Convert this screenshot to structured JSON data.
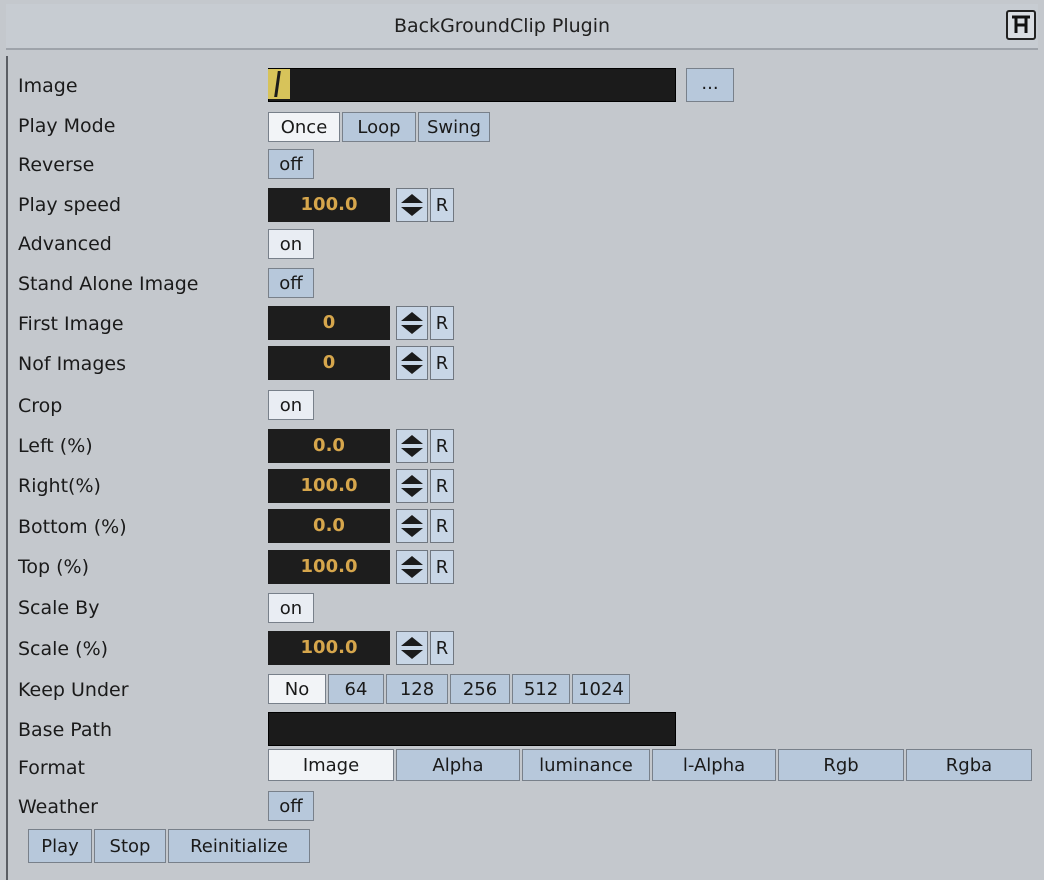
{
  "window": {
    "title": "BackGroundClip Plugin"
  },
  "fields": {
    "image_label": "Image",
    "image_value": ".\\",
    "browse_label": "...",
    "play_mode_label": "Play Mode",
    "play_mode_options": [
      "Once",
      "Loop",
      "Swing"
    ],
    "play_mode_selected": "Once",
    "reverse_label": "Reverse",
    "reverse_value": "off",
    "play_speed_label": "Play speed",
    "play_speed_value": "100.0",
    "advanced_label": "Advanced",
    "advanced_value": "on",
    "stand_alone_label": "Stand Alone Image",
    "stand_alone_value": "off",
    "first_image_label": "First Image",
    "first_image_value": "0",
    "nof_images_label": "Nof Images",
    "nof_images_value": "0",
    "crop_label": "Crop",
    "crop_value": "on",
    "left_label": "Left (%)",
    "left_value": "0.0",
    "right_label": "Right(%)",
    "right_value": "100.0",
    "bottom_label": "Bottom (%)",
    "bottom_value": "0.0",
    "top_label": "Top (%)",
    "top_value": "100.0",
    "scale_by_label": "Scale By",
    "scale_by_value": "on",
    "scale_label": "Scale (%)",
    "scale_value": "100.0",
    "keep_under_label": "Keep Under",
    "keep_under_options": [
      "No",
      "64",
      "128",
      "256",
      "512",
      "1024"
    ],
    "keep_under_selected": "No",
    "base_path_label": "Base Path",
    "base_path_value": "",
    "format_label": "Format",
    "format_options": [
      "Image",
      "Alpha",
      "luminance",
      "l-Alpha",
      "Rgb",
      "Rgba"
    ],
    "format_selected": "Image",
    "weather_label": "Weather",
    "weather_value": "off",
    "reset_label": "R"
  },
  "actions": {
    "play": "Play",
    "stop": "Stop",
    "reinitialize": "Reinitialize"
  },
  "colors": {
    "background": "#c4c8cd",
    "field": "#1b1b1b",
    "number": "#d6a64c",
    "button": "#b7c8db",
    "button_active": "#f2f4f7"
  },
  "icons": {
    "title_icon": "plugin-icon",
    "spinner": "spinner-arrows-icon"
  }
}
